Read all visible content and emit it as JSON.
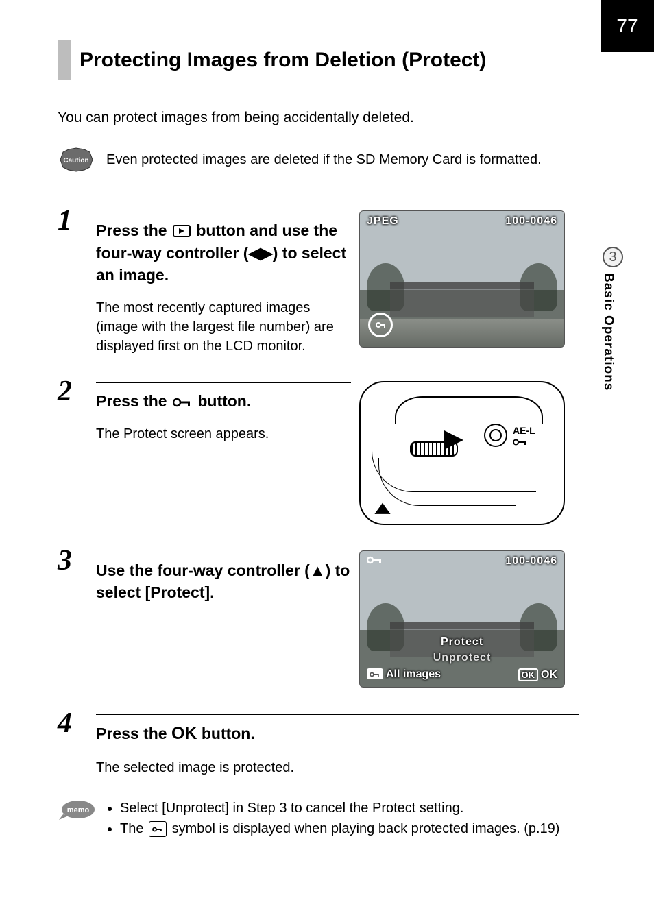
{
  "page_number": "77",
  "chapter": {
    "number": "3",
    "title": "Basic Operations"
  },
  "heading": "Protecting Images from Deletion (Protect)",
  "intro": "You can protect images from being accidentally deleted.",
  "caution": {
    "label": "Caution",
    "text": "Even protected images are deleted if the SD Memory Card is formatted."
  },
  "steps": [
    {
      "num": "1",
      "title_before": "Press the ",
      "title_icon_name": "playback-icon",
      "title_mid": " button and use the four-way controller (",
      "title_arrows": "◀▶",
      "title_after": ") to select an image.",
      "desc": "The most recently captured images (image with the largest file number) are displayed first on the LCD monitor.",
      "figure": {
        "type": "lcd",
        "top_left": "JPEG",
        "top_right": "100-0046",
        "protect_overlay": true
      }
    },
    {
      "num": "2",
      "title_before": "Press the ",
      "title_icon_name": "protect-key-icon",
      "title_after": " button.",
      "desc": "The Protect screen appears.",
      "figure": {
        "type": "camera",
        "ael_label": "AE-L"
      }
    },
    {
      "num": "3",
      "title_before": "Use the four-way controller (",
      "title_arrows": "▲",
      "title_after": ") to select [Protect].",
      "figure": {
        "type": "lcd-menu",
        "top_right": "100-0046",
        "options": [
          "Protect",
          "Unprotect"
        ],
        "selected_index": 0,
        "bottom_left_label": "All images",
        "bottom_right_label": "OK",
        "bottom_right_button": "OK"
      }
    },
    {
      "num": "4",
      "title_before": "Press the ",
      "title_ok": "OK",
      "title_after": " button.",
      "desc": "The selected image is protected."
    }
  ],
  "memo": {
    "label": "memo",
    "items": [
      "Select [Unprotect] in Step 3 to cancel the Protect setting.",
      "The  symbol is displayed when playing back protected images. (p.19)"
    ],
    "item2_prefix": "The ",
    "item2_suffix": " symbol is displayed when playing back protected images. (p.19)"
  }
}
